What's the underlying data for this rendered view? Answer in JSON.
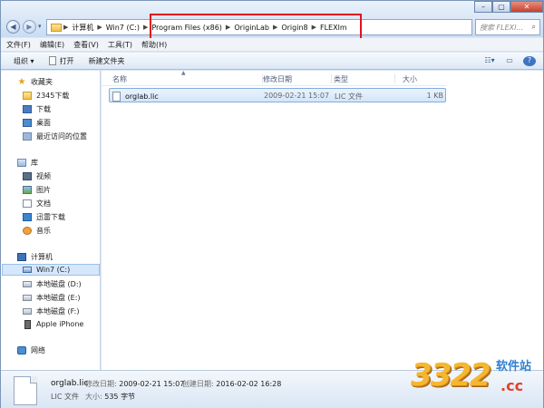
{
  "window": {
    "controls": [
      "–",
      "▢",
      "✕"
    ]
  },
  "address": {
    "breadcrumb": [
      "计算机",
      "Win7 (C:)",
      "Program Files (x86)",
      "OriginLab",
      "Origin8",
      "FLEXlm"
    ],
    "search_placeholder": "搜索 FLEXl..."
  },
  "menu": [
    "文件(F)",
    "编辑(E)",
    "查看(V)",
    "工具(T)",
    "帮助(H)"
  ],
  "toolbar": {
    "organize": "组织 ▾",
    "open": "打开",
    "new_folder": "新建文件夹"
  },
  "sidebar": {
    "favorites": "收藏夹",
    "fav_items": [
      "2345下载",
      "下载",
      "桌面",
      "最近访问的位置"
    ],
    "libraries": "库",
    "lib_items": [
      "视频",
      "图片",
      "文档",
      "迅雷下载",
      "音乐"
    ],
    "computer": "计算机",
    "drives": [
      "Win7 (C:)",
      "本地磁盘 (D:)",
      "本地磁盘 (E:)",
      "本地磁盘 (F:)",
      "Apple iPhone"
    ],
    "network": "网络"
  },
  "columns": [
    "名称",
    "修改日期",
    "类型",
    "大小"
  ],
  "files": [
    {
      "name": "orglab.lic",
      "modified": "2009-02-21 15:07",
      "type": "LIC 文件",
      "size": "1 KB"
    }
  ],
  "details": {
    "name": "orglab.lic",
    "type": "LIC 文件",
    "modified_label": "修改日期:",
    "modified": "2009-02-21 15:07",
    "size_label": "大小:",
    "size": "535 字节",
    "created_label": "创建日期:",
    "created": "2016-02-02 16:28"
  },
  "watermark": {
    "number": "3322",
    "site": "软件站",
    "domain": ".cc"
  },
  "colors": {
    "highlight_box": "#e0141e",
    "selection": "#d6e7fb"
  }
}
